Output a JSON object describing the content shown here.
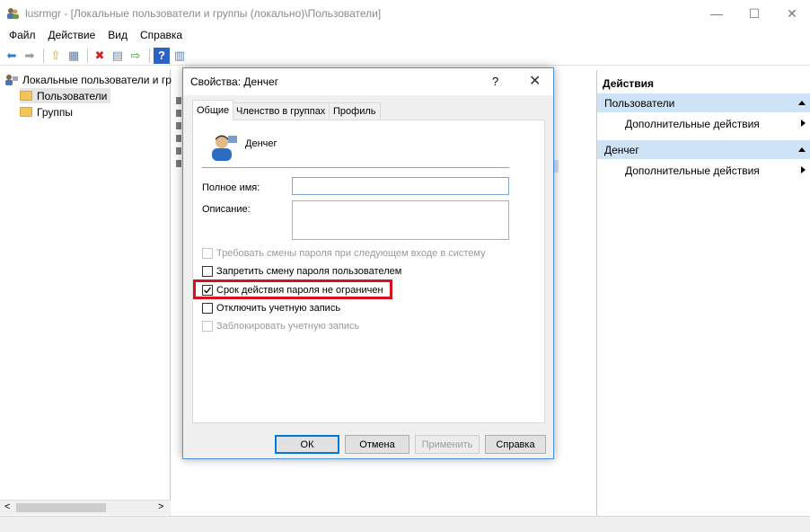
{
  "window": {
    "title": "lusrmgr - [Локальные пользователи и группы (локально)\\Пользователи]",
    "minimize": "—",
    "maximize": "☐",
    "close": "✕"
  },
  "menu": [
    "Файл",
    "Действие",
    "Вид",
    "Справка"
  ],
  "toolbar": {
    "icons": [
      "back-arrow-icon",
      "forward-arrow-icon",
      "up-folder-icon",
      "show-hide-tree-icon",
      "delete-icon",
      "properties-icon",
      "export-list-icon",
      "help-icon",
      "action-pane-icon"
    ],
    "glyphs": [
      "⬅",
      "➡",
      "⇧",
      "▦",
      "✖",
      "▤",
      "⇨",
      "?",
      "▥"
    ]
  },
  "tree": {
    "root": "Локальные пользователи и гр",
    "items": [
      "Пользователи",
      "Группы"
    ],
    "scroll_left": "<",
    "scroll_right": ">"
  },
  "actions": {
    "header": "Действия",
    "sections": [
      {
        "title": "Пользователи",
        "item": "Дополнительные действия"
      },
      {
        "title": "Денчег",
        "item": "Дополнительные действия"
      }
    ]
  },
  "dialog": {
    "title": "Свойства: Денчег",
    "help": "?",
    "close": "✕",
    "tabs": [
      "Общие",
      "Членство в группах",
      "Профиль"
    ],
    "user_name": "Денчег",
    "full_name_label": "Полное имя:",
    "full_name_value": "",
    "description_label": "Описание:",
    "description_value": "",
    "checkboxes": [
      {
        "label": "Требовать смены пароля при следующем входе в систему",
        "checked": false,
        "enabled": false
      },
      {
        "label": "Запретить смену пароля пользователем",
        "checked": false,
        "enabled": true
      },
      {
        "label": "Срок действия пароля не ограничен",
        "checked": true,
        "enabled": true
      },
      {
        "label": "Отключить учетную запись",
        "checked": false,
        "enabled": true
      },
      {
        "label": "Заблокировать учетную запись",
        "checked": false,
        "enabled": false
      }
    ],
    "buttons": {
      "ok": "ОК",
      "cancel": "Отмена",
      "apply": "Применить",
      "help": "Справка"
    }
  },
  "colors": {
    "highlight": "#d6121d",
    "selection": "#cfe3f7",
    "accent": "#0078d7"
  }
}
